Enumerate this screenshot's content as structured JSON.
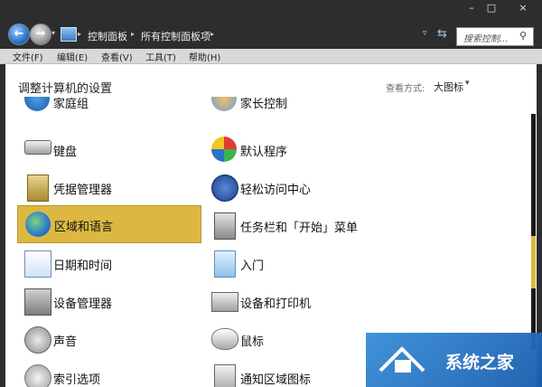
{
  "window": {
    "minimize": "–",
    "maximize": "□",
    "close": "×"
  },
  "address": {
    "crumb1": "控制面板",
    "sep1": "▸",
    "crumb2": "所有控制面板项",
    "sep2": "▸"
  },
  "search": {
    "placeholder": "搜索控制..."
  },
  "menu": [
    "文件(F)",
    "编辑(E)",
    "查看(V)",
    "工具(T)",
    "帮助(H)"
  ],
  "content": {
    "heading": "调整计算机的设置",
    "view_by_label": "查看方式:",
    "view_by_value": "大图标"
  },
  "items": {
    "left": [
      "家庭组",
      "键盘",
      "凭据管理器",
      "区域和语言",
      "日期和时间",
      "设备管理器",
      "声音",
      "索引选项"
    ],
    "right": [
      "家长控制",
      "默认程序",
      "轻松访问中心",
      "任务栏和「开始」菜单",
      "入门",
      "设备和打印机",
      "鼠标",
      "通知区域图标"
    ]
  },
  "selected_item": "区域和语言",
  "watermark": "系统之家",
  "colors": {
    "selection": "#dcb842",
    "accent_blue": "#2a71c8"
  }
}
